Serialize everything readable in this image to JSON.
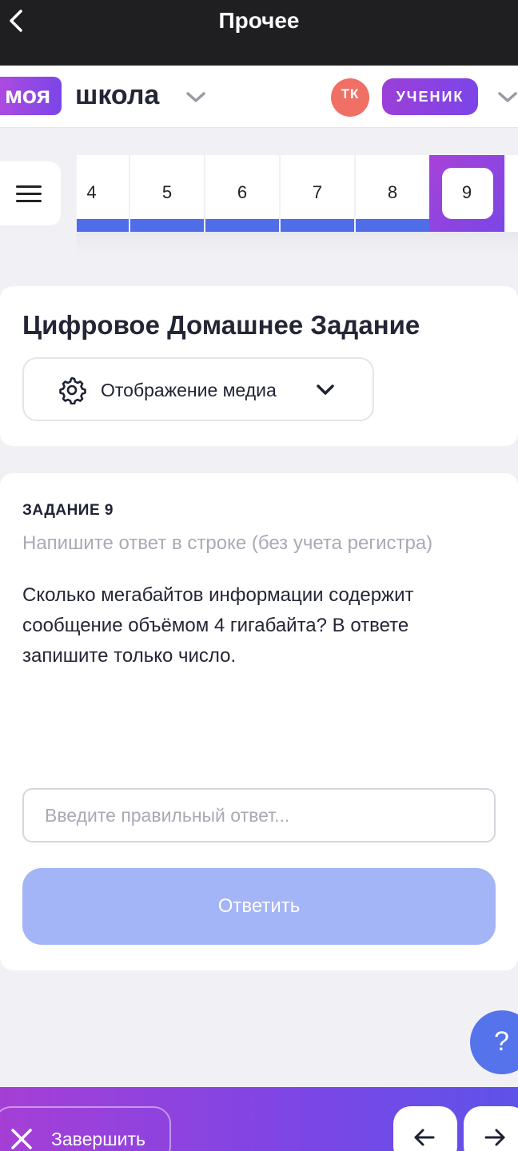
{
  "header": {
    "title": "Прочее",
    "back_icon": "chevron-left-icon"
  },
  "brand": {
    "logo_part1": "моя",
    "logo_part2": "школа",
    "user_initials": "ТК",
    "role": "УЧЕНИК"
  },
  "task_nav": {
    "numbers": [
      "4",
      "5",
      "6",
      "7",
      "8",
      "9"
    ],
    "active": "9"
  },
  "section": {
    "title": "Цифровое Домашнее Задание",
    "media_label": "Отображение медиа"
  },
  "task": {
    "label": "ЗАДАНИЕ 9",
    "hint": "Напишите ответ в строке (без учета регистра)",
    "question": "Сколько мегабайтов информации содержит сообщение объёмом 4 гигабайта? В ответе запишите только число.",
    "answer_placeholder": "Введите правильный ответ...",
    "answer_value": "",
    "submit_label": "Ответить"
  },
  "help": {
    "label": "?"
  },
  "footer": {
    "finish_label": "Завершить"
  },
  "colors": {
    "accent_purple": "#9b3fd8",
    "accent_blue": "#4f6de8",
    "submit_disabled": "#a3b4f7",
    "avatar": "#f07066"
  }
}
